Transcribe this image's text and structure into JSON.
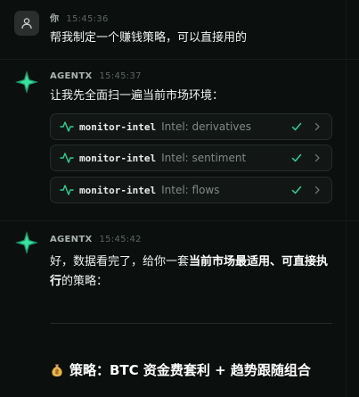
{
  "messages": [
    {
      "sender": "你",
      "time": "15:45:36",
      "text": "帮我制定一个赚钱策略，可以直接用的"
    },
    {
      "sender": "AGENTX",
      "time": "15:45:37",
      "text": "让我先全面扫一遍当前市场环境：",
      "tools": [
        {
          "name": "monitor-intel",
          "detail": "Intel: derivatives"
        },
        {
          "name": "monitor-intel",
          "detail": "Intel: sentiment"
        },
        {
          "name": "monitor-intel",
          "detail": "Intel: flows"
        }
      ]
    },
    {
      "sender": "AGENTX",
      "time": "15:45:42",
      "text_plain_1": "好，数据看完了，给你一套",
      "text_bold": "当前市场最适用、可直接执行",
      "text_plain_2": "的策略：",
      "heading": "策略：BTC 资金费套利 + 趋势跟随组合"
    }
  ],
  "colors": {
    "accent": "#22c98a",
    "check": "#2fd08f",
    "background": "#0b0f0e"
  },
  "icons": {
    "user": "user-icon",
    "agent": "agent-star-icon",
    "tool": "pulse-icon",
    "done": "check-icon",
    "expand": "chevron-right-icon",
    "heading": "money-bag-icon"
  }
}
